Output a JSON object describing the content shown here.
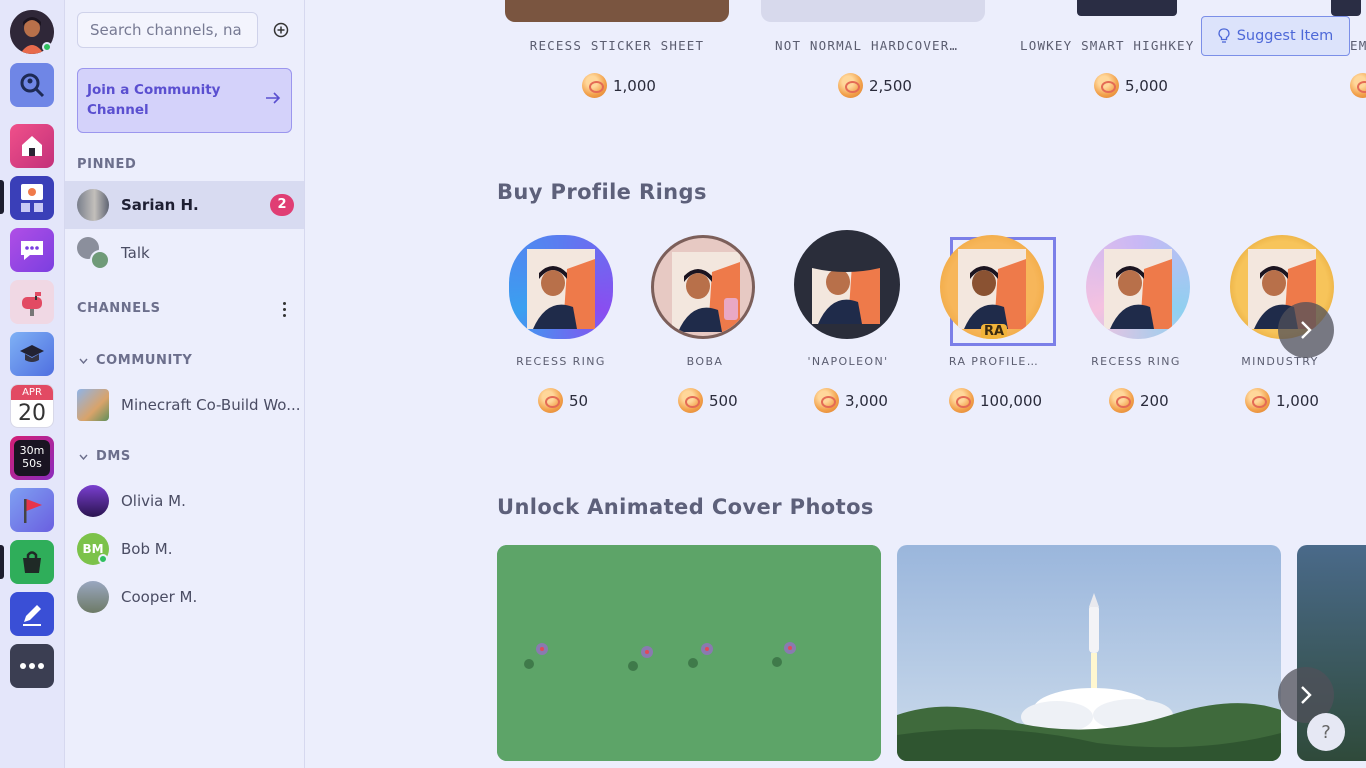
{
  "rail": {
    "calendar": {
      "month": "APR",
      "day": "20"
    },
    "timer": {
      "line1": "30m",
      "line2": "50s"
    }
  },
  "sidebar": {
    "search_placeholder": "Search channels, na",
    "join_label": "Join a Community Channel",
    "pinned_title": "PINNED",
    "pinned": [
      {
        "name": "Sarian H.",
        "badge": "2"
      },
      {
        "name": "Talk"
      }
    ],
    "channels_title": "CHANNELS",
    "community_title": "COMMUNITY",
    "community": [
      {
        "name": "Minecraft Co-Build Wo..."
      }
    ],
    "dms_title": "DMS",
    "dms": [
      {
        "name": "Olivia M."
      },
      {
        "name": "Bob M.",
        "initials": "BM"
      },
      {
        "name": "Cooper M."
      }
    ]
  },
  "main": {
    "suggest_label": "Suggest Item",
    "shop_items": [
      {
        "name": "RECESS STICKER SHEET",
        "price": "1,000"
      },
      {
        "name": "NOT NORMAL HARDCOVER…",
        "price": "2,500"
      },
      {
        "name": "LOWKEY SMART HIGHKEY G",
        "price": "5,000"
      },
      {
        "name": "EM",
        "price": ""
      }
    ],
    "rings_title": "Buy Profile Rings",
    "rings": [
      {
        "name": "RECESS RING",
        "price": "50"
      },
      {
        "name": "BOBA",
        "price": "500"
      },
      {
        "name": "'NAPOLEON'",
        "price": "3,000"
      },
      {
        "name": "RA PROFILE…",
        "price": "100,000",
        "ring_text": "RA"
      },
      {
        "name": "RECESS RING",
        "price": "200"
      },
      {
        "name": "MINDUSTRY",
        "price": "1,000"
      }
    ],
    "covers_title": "Unlock Animated Cover Photos",
    "help_label": "?"
  },
  "colors": {
    "accent": "#5a4fd0",
    "badge": "#e03e74",
    "online": "#2fbf5f",
    "background": "#eceefc"
  }
}
